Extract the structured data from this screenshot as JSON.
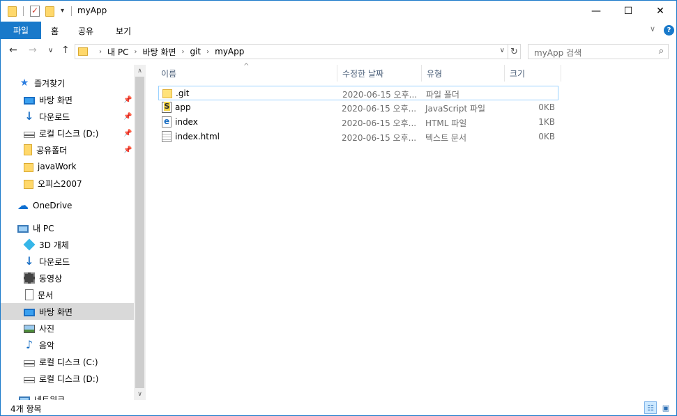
{
  "titlebar": {
    "title": "myApp",
    "minimize": "—",
    "maximize": "☐",
    "close": "✕",
    "qa_dropdown": "▾"
  },
  "ribbon": {
    "file_tab": "파일",
    "tabs": [
      "홈",
      "공유",
      "보기"
    ],
    "collapse": "∨",
    "help": "?"
  },
  "nav": {
    "back": "←",
    "forward": "→",
    "recent": "∨",
    "up": "↑",
    "breadcrumbs": [
      "내 PC",
      "바탕 화면",
      "git",
      "myApp"
    ],
    "crumb_sep": "›",
    "dropdown": "∨",
    "refresh": "↻"
  },
  "search": {
    "placeholder": "myApp 검색",
    "icon": "⌕"
  },
  "sidebar": {
    "items": [
      {
        "label": "즐겨찾기",
        "icon": "star-icon",
        "pinned": false
      },
      {
        "label": "바탕 화면",
        "icon": "desktop-icon",
        "pinned": true
      },
      {
        "label": "다운로드",
        "icon": "download-icon",
        "pinned": true
      },
      {
        "label": "로컬 디스크 (D:)",
        "icon": "drive-icon",
        "pinned": true
      },
      {
        "label": "공유폴더",
        "icon": "shared-folder-icon",
        "pinned": true
      },
      {
        "label": "javaWork",
        "icon": "folder-icon",
        "pinned": false
      },
      {
        "label": "오피스2007",
        "icon": "folder-icon",
        "pinned": false
      },
      {
        "label": "OneDrive",
        "icon": "cloud-icon",
        "pinned": false
      },
      {
        "label": "내 PC",
        "icon": "pc-icon",
        "pinned": false
      },
      {
        "label": "3D 개체",
        "icon": "3d-objects-icon",
        "pinned": false
      },
      {
        "label": "다운로드",
        "icon": "download-icon",
        "pinned": false
      },
      {
        "label": "동영상",
        "icon": "video-icon",
        "pinned": false
      },
      {
        "label": "문서",
        "icon": "document-icon",
        "pinned": false
      },
      {
        "label": "바탕 화면",
        "icon": "desktop-icon",
        "pinned": false,
        "selected": true
      },
      {
        "label": "사진",
        "icon": "picture-icon",
        "pinned": false
      },
      {
        "label": "음악",
        "icon": "music-icon",
        "pinned": false
      },
      {
        "label": "로컬 디스크 (C:)",
        "icon": "drive-icon",
        "pinned": false
      },
      {
        "label": "로컬 디스크 (D:)",
        "icon": "drive-icon",
        "pinned": false
      },
      {
        "label": "네트워크",
        "icon": "network-icon",
        "pinned": false
      }
    ],
    "pin_glyph": "📌"
  },
  "filelist": {
    "columns": [
      "이름",
      "수정한 날짜",
      "유형",
      "크기"
    ],
    "sort_arrow": "^",
    "rows": [
      {
        "name": ".git",
        "modified": "2020-06-15 오후...",
        "type": "파일 폴더",
        "size": "",
        "icon": "folder-icon"
      },
      {
        "name": "app",
        "modified": "2020-06-15 오후...",
        "type": "JavaScript 파일",
        "size": "0KB",
        "icon": "javascript-file-icon"
      },
      {
        "name": "index",
        "modified": "2020-06-15 오후...",
        "type": "HTML 파일",
        "size": "1KB",
        "icon": "html-file-icon"
      },
      {
        "name": "index.html",
        "modified": "2020-06-15 오후...",
        "type": "텍스트 문서",
        "size": "0KB",
        "icon": "text-file-icon"
      }
    ]
  },
  "statusbar": {
    "item_count": "4개 항목",
    "details_view": "☷",
    "large_icons_view": "▣"
  },
  "scrollbar": {
    "up": "∧",
    "down": "∨"
  },
  "colors": {
    "accent": "#1979ca",
    "selection": "#d9d9d9",
    "row_selection_border": "#99d1ff",
    "header_text": "#4c607a"
  }
}
